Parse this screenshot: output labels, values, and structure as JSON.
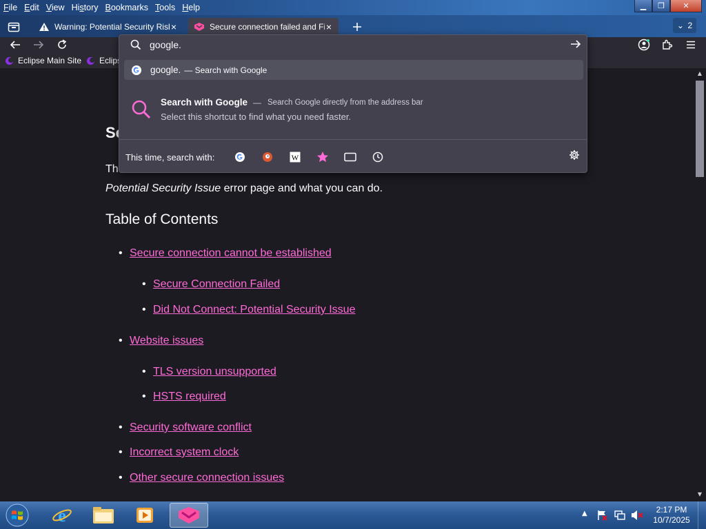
{
  "menu": {
    "items": [
      {
        "u": "F",
        "rest": "ile"
      },
      {
        "u": "E",
        "rest": "dit"
      },
      {
        "u": "V",
        "rest": "iew"
      },
      {
        "pre": "Hi",
        "u": "s",
        "rest": "tory"
      },
      {
        "u": "B",
        "rest": "ookmarks"
      },
      {
        "u": "T",
        "rest": "ools"
      },
      {
        "u": "H",
        "rest": "elp"
      }
    ]
  },
  "tabs": [
    {
      "title": "Warning: Potential Security Risk",
      "close": "×"
    },
    {
      "title": "Secure connection failed and Fi",
      "close": "×"
    }
  ],
  "tab_count": "2",
  "bookmarks": [
    "Eclipse Main Site",
    "Eclips"
  ],
  "urlbar": {
    "value": "google.",
    "suggestion_text": "google.",
    "suggestion_sub": "— Search with Google",
    "shortcut_title": "Search with Google",
    "shortcut_sep": "—",
    "shortcut_desc": "Search Google directly from the address bar",
    "shortcut_hint": "Select this shortcut to find what you need faster.",
    "search_with_label": "This time, search with:"
  },
  "page": {
    "heading": "Se",
    "intro_line1": "Th",
    "intro_line2_italic": "Potential Security Issue",
    "intro_line2_rest": " error page and what you can do.",
    "toc_heading": "Table of Contents",
    "toc": [
      {
        "label": "Secure connection cannot be established",
        "level": 1
      },
      {
        "label": "Secure Connection Failed",
        "level": 2
      },
      {
        "label": "Did Not Connect: Potential Security Issue",
        "level": 2
      },
      {
        "label": "Website issues",
        "level": 1
      },
      {
        "label": "TLS version unsupported",
        "level": 2
      },
      {
        "label": "HSTS required",
        "level": 2
      },
      {
        "label": "Security software conflict",
        "level": 1
      },
      {
        "label": "Incorrect system clock",
        "level": 1
      },
      {
        "label": "Other secure connection issues",
        "level": 1
      }
    ]
  },
  "taskbar": {
    "time": "2:17 PM",
    "date": "10/7/2025"
  },
  "colors": {
    "link": "#ff6bd6",
    "accent": "#ff6bd6",
    "urlbar_bg": "#42414d"
  }
}
